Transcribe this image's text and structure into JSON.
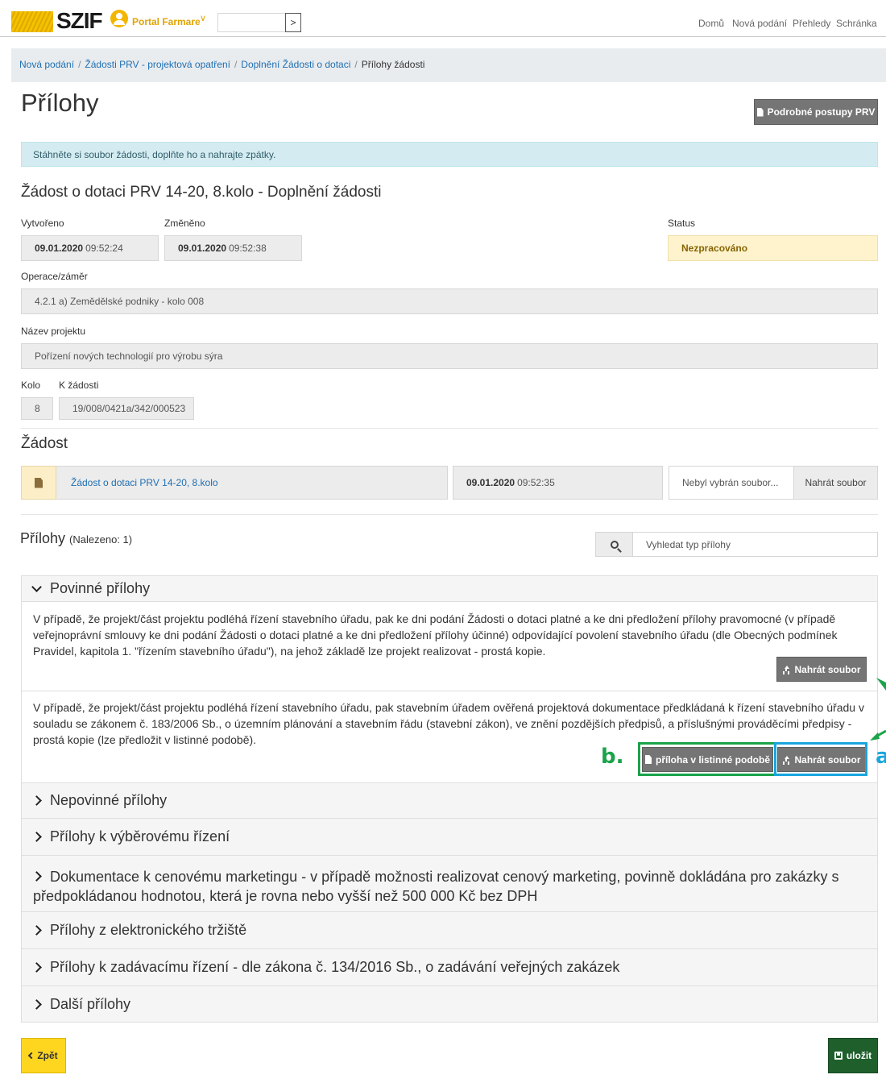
{
  "header": {
    "logo_text": "SZIF",
    "portal_label": "Portal Farmare",
    "search_button": ">",
    "nav": [
      "Domů",
      "Nová podání",
      "Přehledy",
      "Schránka"
    ]
  },
  "breadcrumb": {
    "items": [
      "Nová podání",
      "Žádosti PRV - projektová opatření",
      "Doplnění Žádosti o dotaci"
    ],
    "current": "Přílohy žádosti"
  },
  "page": {
    "title": "Přílohy",
    "procedures_button": "Podrobné postupy PRV",
    "alert": "Stáhněte si soubor žádosti, doplňte ho a nahrajte zpátky."
  },
  "request": {
    "title": "Žádost o dotaci PRV 14-20, 8.kolo - Doplnění žádosti",
    "created_label": "Vytvořeno",
    "created_date": "09.01.2020",
    "created_time": "09:52:24",
    "changed_label": "Změněno",
    "changed_date": "09.01.2020",
    "changed_time": "09:52:38",
    "status_label": "Status",
    "status_value": "Nezpracováno",
    "operation_label": "Operace/záměr",
    "operation_value": "4.2.1 a) Zemědělské podniky - kolo 008",
    "project_label": "Název projektu",
    "project_value": "Pořízení nových technologií pro výrobu sýra",
    "round_label": "Kolo",
    "round_value": "8",
    "ref_label": "K žádosti",
    "ref_value": "19/008/0421a/342/000523"
  },
  "zadost": {
    "section_title": "Žádost",
    "file_link": "Žádost o dotaci PRV 14-20, 8.kolo",
    "file_date": "09.01.2020",
    "file_time": "09:52:35",
    "file_input_placeholder": "Nebyl vybrán soubor...",
    "upload_button": "Nahrát soubor"
  },
  "attachments": {
    "title": "Přílohy",
    "count": "(Nalezeno: 1)",
    "search_placeholder": "Vyhledat typ přílohy",
    "groups": [
      "Povinné přílohy",
      "Nepovinné přílohy",
      "Přílohy k výběrovému řízení",
      "Dokumentace k cenovému marketingu - v případě možnosti realizovat cenový marketing, povinně dokládána pro zakázky s předpokládanou hodnotou, která je rovna nebo vyšší než 500 000 Kč bez DPH",
      "Přílohy z elektronického tržiště",
      "Přílohy k zadávacímu řízení - dle zákona č. 134/2016 Sb., o zadávání veřejných zakázek",
      "Další přílohy"
    ],
    "mandatory_items": [
      {
        "text": "V případě, že projekt/část projektu podléhá řízení stavebního úřadu, pak ke dni podání Žádosti o dotaci platné a ke dni předložení přílohy pravomocné (v případě veřejnoprávní smlouvy ke dni podání Žádosti o dotaci platné a ke dni předložení přílohy účinné) odpovídající povolení stavebního úřadu (dle Obecných podmínek Pravidel, kapitola 1. \"řízením stavebního úřadu\"), na jehož základě lze projekt realizovat - prostá kopie.",
        "upload_button": "Nahrát soubor"
      },
      {
        "text": "V případě, že projekt/část projektu podléhá řízení stavebního úřadu, pak stavebním úřadem ověřená projektová dokumentace předkládaná k řízení stavebního úřadu v souladu se zákonem č. 183/2006 Sb., o územním plánování a stavebním řádu (stavební zákon), ve znění pozdějších předpisů, a příslušnými prováděcími předpisy - prostá kopie (lze předložit v listinné podobě).",
        "paper_button": "příloha v listinné podobě",
        "upload_button": "Nahrát soubor"
      }
    ]
  },
  "annotations": {
    "a": "a",
    "b": "b.",
    "color_a": "#19a6dd",
    "color_b": "#1aa34a"
  },
  "footer": {
    "back_button": "Zpět",
    "save_button": "uložit"
  }
}
